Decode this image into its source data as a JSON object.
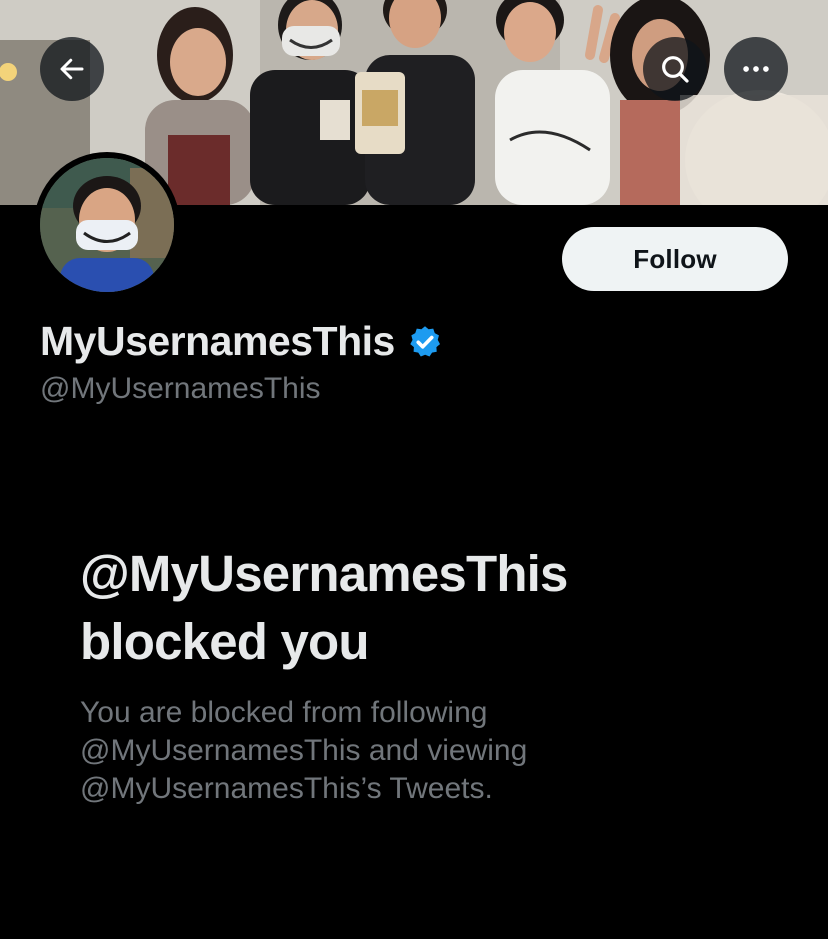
{
  "header": {
    "back_icon": "arrow-left-icon",
    "search_icon": "search-icon",
    "more_icon": "more-horizontal-icon"
  },
  "profile": {
    "display_name": "MyUsernamesThis",
    "verified": true,
    "verified_color": "#1d9bf0",
    "handle": "@MyUsernamesThis",
    "follow_label": "Follow"
  },
  "blocked": {
    "title_line1": "@MyUsernamesThis",
    "title_line2": "blocked you",
    "description_line1": "You are blocked from following",
    "description_line2": "@MyUsernamesThis and viewing",
    "description_line3": "@MyUsernamesThis’s Tweets."
  }
}
